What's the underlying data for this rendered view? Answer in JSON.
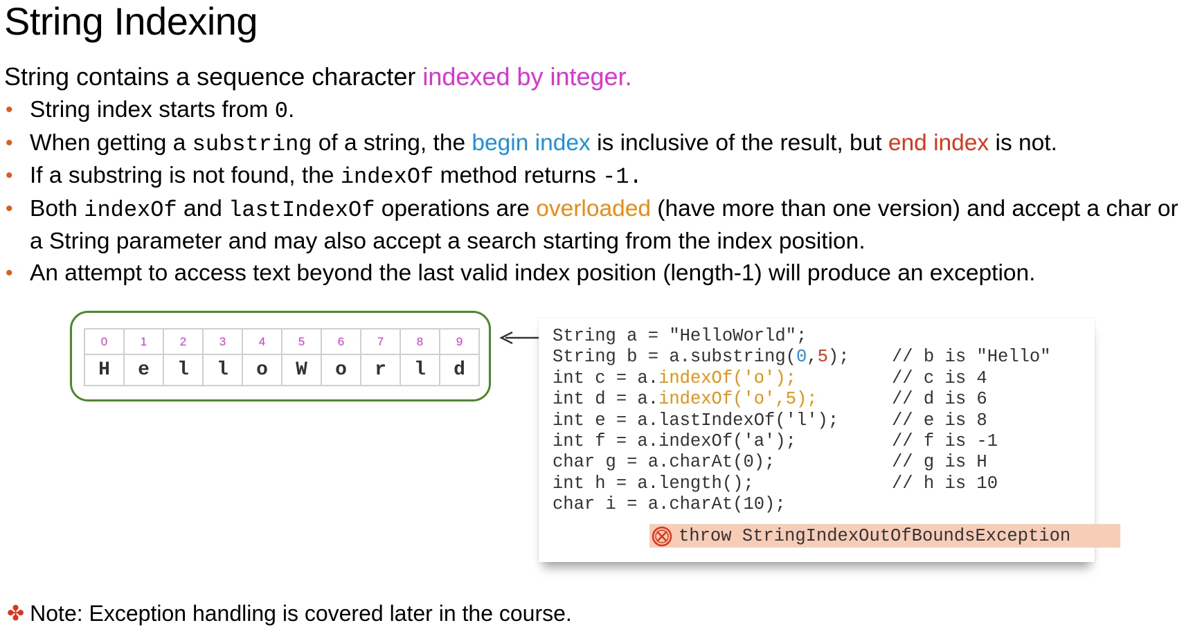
{
  "title": "String Indexing",
  "intro": {
    "text": "String contains a sequence character ",
    "highlight": "indexed by integer."
  },
  "bullets": [
    {
      "segments": [
        {
          "text": "String index starts from ",
          "style": "plain"
        },
        {
          "text": "0",
          "style": "code"
        },
        {
          "text": ".",
          "style": "plain"
        }
      ]
    },
    {
      "segments": [
        {
          "text": "When getting a ",
          "style": "plain"
        },
        {
          "text": "substring",
          "style": "code"
        },
        {
          "text": " of a string, the ",
          "style": "plain"
        },
        {
          "text": "begin index",
          "style": "blue"
        },
        {
          "text": " is inclusive of the result, but ",
          "style": "plain"
        },
        {
          "text": "end index",
          "style": "red"
        },
        {
          "text": " is not.",
          "style": "plain"
        }
      ]
    },
    {
      "segments": [
        {
          "text": "If a substring is not found, the ",
          "style": "plain"
        },
        {
          "text": "indexOf",
          "style": "code"
        },
        {
          "text": " method returns ",
          "style": "plain"
        },
        {
          "text": "-1.",
          "style": "code"
        }
      ]
    },
    {
      "segments": [
        {
          "text": "Both ",
          "style": "plain"
        },
        {
          "text": "indexOf",
          "style": "code"
        },
        {
          "text": " and ",
          "style": "plain"
        },
        {
          "text": "lastIndexOf",
          "style": "code"
        },
        {
          "text": " operations are ",
          "style": "plain"
        },
        {
          "text": "overloaded",
          "style": "orange"
        },
        {
          "text": " (have more than one version) and accept a char or a String parameter and may also accept a search starting from the index position.",
          "style": "plain"
        }
      ]
    },
    {
      "segments": [
        {
          "text": "An attempt to access text beyond the last valid index position (length-1) will produce an exception.",
          "style": "plain"
        }
      ]
    }
  ],
  "diagram": {
    "indices": [
      "0",
      "1",
      "2",
      "3",
      "4",
      "5",
      "6",
      "7",
      "8",
      "9"
    ],
    "chars": [
      "H",
      "e",
      "l",
      "l",
      "o",
      "W",
      "o",
      "r",
      "l",
      "d"
    ]
  },
  "code_lines": [
    {
      "segments": [
        {
          "text": "String a = \"HelloWorld\";",
          "style": "plain"
        }
      ],
      "comment": ""
    },
    {
      "segments": [
        {
          "text": "String b = a.substring(",
          "style": "plain"
        },
        {
          "text": "0",
          "style": "blue"
        },
        {
          "text": ",",
          "style": "plain"
        },
        {
          "text": "5",
          "style": "red"
        },
        {
          "text": ");",
          "style": "plain"
        }
      ],
      "comment": "// b is \"Hello\""
    },
    {
      "segments": [
        {
          "text": "int c = a.",
          "style": "plain"
        },
        {
          "text": "indexOf('o');",
          "style": "orange"
        }
      ],
      "comment": "// c is 4"
    },
    {
      "segments": [
        {
          "text": "int d = a.",
          "style": "plain"
        },
        {
          "text": "indexOf('o',5);",
          "style": "orange"
        }
      ],
      "comment": "// d is 6"
    },
    {
      "segments": [
        {
          "text": "int e = a.lastIndexOf('l');",
          "style": "plain"
        }
      ],
      "comment": "// e is 8"
    },
    {
      "segments": [
        {
          "text": "int f = a.indexOf('a');",
          "style": "plain"
        }
      ],
      "comment": "// f is -1"
    },
    {
      "segments": [
        {
          "text": "char g = a.charAt(0);",
          "style": "plain"
        }
      ],
      "comment": "// g is H"
    },
    {
      "segments": [
        {
          "text": "int h = a.length();",
          "style": "plain"
        }
      ],
      "comment": "// h is 10"
    },
    {
      "segments": [
        {
          "text": "char i = a.charAt(10);",
          "style": "plain"
        }
      ],
      "comment": ""
    }
  ],
  "exception": {
    "icon": "error-circle-x-icon",
    "text": "throw StringIndexOutOfBoundsException"
  },
  "note": {
    "icon": "asterisk-bullet-icon",
    "text": "Note: Exception handling is covered later in the course."
  },
  "colors": {
    "magenta": "#e030d8",
    "blue": "#1e8fe0",
    "red": "#e03418",
    "orange": "#ee8a10",
    "green_border": "#4a8a28",
    "exception_bg": "#f8cdb8"
  }
}
